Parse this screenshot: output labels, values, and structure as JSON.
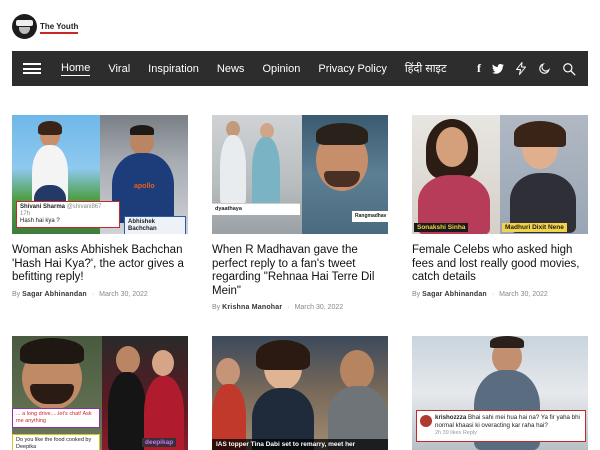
{
  "site": {
    "logo_text": "The Youth"
  },
  "nav": {
    "items": [
      {
        "label": "Home",
        "active": true
      },
      {
        "label": "Viral"
      },
      {
        "label": "Inspiration"
      },
      {
        "label": "News"
      },
      {
        "label": "Opinion"
      },
      {
        "label": "Privacy Policy"
      },
      {
        "label": "हिंदी साइट"
      }
    ],
    "icons": [
      "facebook-icon",
      "twitter-icon",
      "flash-icon",
      "dark-mode-icon",
      "search-icon"
    ]
  },
  "articles": [
    {
      "title": "Woman asks Abhishek Bachchan 'Hash Hai Kya?', the actor gives a befitting reply!",
      "by": "By",
      "author": "Sagar Abhinandan",
      "date": "March 30, 2022",
      "thumb": {
        "tweet_name": "Shivani Sharma",
        "tweet_handle": "@shivani867 · 17h",
        "tweet_text": "Hash hai kya ?",
        "reply_name": "Abhishek Bachchan",
        "jersey_text": "apollo"
      }
    },
    {
      "title": "When R Madhavan gave the perfect reply to a fan's tweet regarding \"Rehnaa Hai Terre Dil Mein\"",
      "by": "By",
      "author": "Krishna Manohar",
      "date": "March 30, 2022",
      "thumb": {
        "tweet_handle": "dyaathaya",
        "reply_handle": "Rangmadhav"
      }
    },
    {
      "title": "Female Celebs who asked high fees and lost really good movies, catch details",
      "by": "By",
      "author": "Sagar Abhinandan",
      "date": "March 30, 2022",
      "thumb": {
        "tag_left": "Sonakshi Sinha",
        "tag_right": "Madhuri Dixit Nene"
      }
    },
    {
      "thumb": {
        "caption_left": "... a long drive.....let's chat! Ask me anything",
        "caption_bottom": "Do you like the food cooked by Deepika",
        "tag_right": "deepikap"
      }
    },
    {
      "thumb": {
        "caption": "IAS topper Tina Dabi set to remarry, meet her"
      }
    },
    {
      "thumb": {
        "comment_user": "krishozzza",
        "comment_text": "Bhai sahi mei hua hai na? Ya fir yaha bhi normal khaasi ki overacting kar raha hai?",
        "comment_meta": "2h   39 likes   Reply"
      }
    }
  ]
}
